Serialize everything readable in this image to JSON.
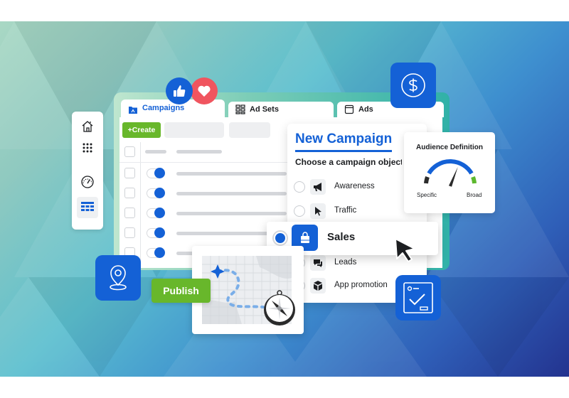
{
  "colors": {
    "brand_blue": "#1461d6",
    "create_green": "#68b72b",
    "heart_red": "#f0555f",
    "gauge_green": "#5cb82e",
    "gauge_dark": "#2b2b2b"
  },
  "tabs": [
    {
      "label": "Campaigns",
      "icon": "folder-icon",
      "active": true
    },
    {
      "label": "Ad Sets",
      "icon": "grid-icon",
      "active": false
    },
    {
      "label": "Ads",
      "icon": "window-icon",
      "active": false
    }
  ],
  "toolbar": {
    "create_label": "+Create"
  },
  "sidebar": {
    "items": [
      {
        "icon": "home-icon",
        "active": false
      },
      {
        "icon": "apps-grid-icon",
        "active": false
      },
      {
        "icon": "dashboard-gauge-icon",
        "active": false
      },
      {
        "icon": "table-icon",
        "active": true
      }
    ]
  },
  "table": {
    "rows": [
      {
        "toggle_on": true
      },
      {
        "toggle_on": true
      },
      {
        "toggle_on": true
      },
      {
        "toggle_on": true
      },
      {
        "toggle_on": true
      }
    ]
  },
  "reactions": [
    {
      "icon": "thumbs-up-icon"
    },
    {
      "icon": "heart-icon"
    }
  ],
  "new_campaign": {
    "title": "New Campaign",
    "subtitle": "Choose a campaign objective",
    "options": [
      {
        "label": "Awareness",
        "icon": "megaphone-icon",
        "selected": false
      },
      {
        "label": "Traffic",
        "icon": "cursor-icon",
        "selected": false
      },
      {
        "label": "Sales",
        "icon": "shopping-bag-icon",
        "selected": true
      },
      {
        "label": "Leads",
        "icon": "chat-bubbles-icon",
        "selected": false
      },
      {
        "label": "App promotion",
        "icon": "cube-icon",
        "selected": false
      }
    ]
  },
  "audience": {
    "title": "Audience Definition",
    "left_label": "Specific",
    "right_label": "Broad",
    "needle_level": 0.62
  },
  "publish": {
    "label": "Publish"
  },
  "tiles": [
    {
      "icon": "dollar-icon"
    },
    {
      "icon": "location-pin-icon"
    },
    {
      "icon": "checklist-icon"
    }
  ]
}
